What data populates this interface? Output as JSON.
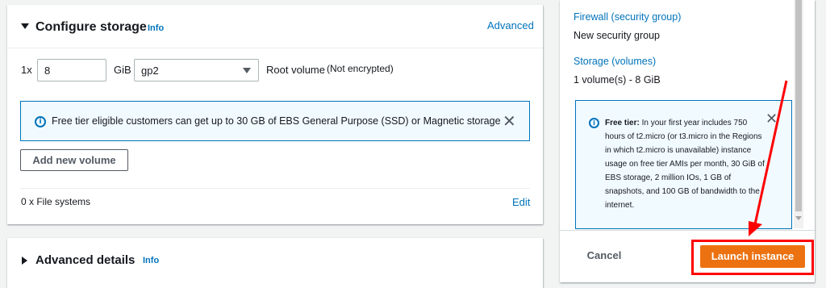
{
  "storage": {
    "title": "Configure storage",
    "info": "Info",
    "advanced": "Advanced",
    "volume": {
      "count_prefix": "1x",
      "size_value": "8",
      "size_unit": "GiB",
      "type_value": "gp2",
      "root_label": "Root volume",
      "encryption": "(Not encrypted)"
    },
    "free_tier_alert": "Free tier eligible customers can get up to 30 GB of EBS General Purpose (SSD) or Magnetic storage",
    "add_volume": "Add new volume",
    "file_systems": "0 x File systems",
    "edit": "Edit"
  },
  "advanced_details": {
    "title": "Advanced details",
    "info": "Info"
  },
  "summary": {
    "firewall_label": "Firewall (security group)",
    "firewall_value": "New security group",
    "storage_label": "Storage (volumes)",
    "storage_value": "1 volume(s) - 8 GiB",
    "free_tier_title": "Free tier:",
    "free_tier_body": "In your first year includes 750 hours of t2.micro (or t3.micro in the Regions in which t2.micro is unavailable) instance usage on free tier AMIs per month, 30 GiB of EBS storage, 2 million IOs, 1 GB of snapshots, and 100 GB of bandwidth to the internet.",
    "cancel": "Cancel",
    "launch": "Launch instance"
  },
  "colors": {
    "link": "#0073bb",
    "primary": "#ec7211",
    "highlight": "#ff0000"
  }
}
